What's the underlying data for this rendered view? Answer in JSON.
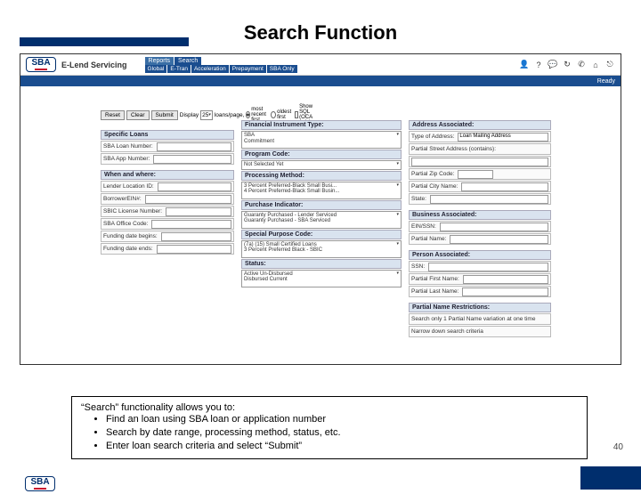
{
  "title": "Search Function",
  "logo_text": "SBA",
  "brand": "E-Lend Servicing",
  "top_tabs": {
    "reports": "Reports",
    "search": "Search"
  },
  "sub_tabs": [
    "Global",
    "E-Tran",
    "Acceleration",
    "Prepayment",
    "SBA Only"
  ],
  "status_ready": "Ready",
  "toolbar": {
    "reset": "Reset",
    "clear": "Clear",
    "submit": "Submit",
    "display_pre": "Display",
    "display_val": "25",
    "display_post": "loans/page,",
    "radio_recent": "most recent first",
    "radio_oldest": "oldest first",
    "show_sql": "Show SQL (OCA only)"
  },
  "col1": {
    "sec1": "Specific Loans",
    "f1": "SBA Loan Number:",
    "f2": "SBA App Number:",
    "sec2": "When and where:",
    "f3": "Lender Location ID:",
    "f4": "BorrowerEIN#:",
    "f5": "SBIC License Number:",
    "f6": "SBA Office Code:",
    "f7": "Funding date begins:",
    "f8": "Funding date ends:"
  },
  "col2": {
    "h1": "Financial Instrument Type:",
    "v1": "SBA\nCommitment",
    "h2": "Program Code:",
    "v2": "Not Selected Yet",
    "h3": "Processing Method:",
    "v3": "3 Percent Preferred-Black Small Busi...\n4 Percent Preferred-Black Small Busin...",
    "h4": "Purchase Indicator:",
    "v4": "Guaranty Purchased - Lender Serviced\nGuaranty Purchased - SBA Serviced",
    "h5": "Special Purpose Code:",
    "v5": "(7a) (15) Small Certified Loans\n3 Percent Preferred Black - SBIC",
    "h6": "Status:",
    "v6": "Active Un-Disbursed\nDisbursed Current"
  },
  "col3": {
    "sec1": "Address Associated:",
    "f1": "Type of Address:",
    "f1v": "Loan Mailing Address",
    "f2": "Partial Street Address (contains):",
    "f3": "Partial Zip Code:",
    "f4": "Partial City Name:",
    "f5": "State:",
    "sec2": "Business Associated:",
    "f6": "EIN/SSN:",
    "f7": "Partial Name:",
    "sec3": "Person Associated:",
    "f8": "SSN:",
    "f9": "Partial First Name:",
    "f10": "Partial Last Name:",
    "sec4": "Partial Name Restrictions:",
    "note1": "Search only 1 Partial Name variation at one time",
    "note2": "Narrow down search criteria"
  },
  "notes": {
    "lead": "“Search” functionality allows you to:",
    "b1": "Find an loan using SBA loan or application number",
    "b2": "Search by date range, processing method, status, etc.",
    "b3": "Enter loan search criteria and select “Submit”"
  },
  "page_number": "40"
}
